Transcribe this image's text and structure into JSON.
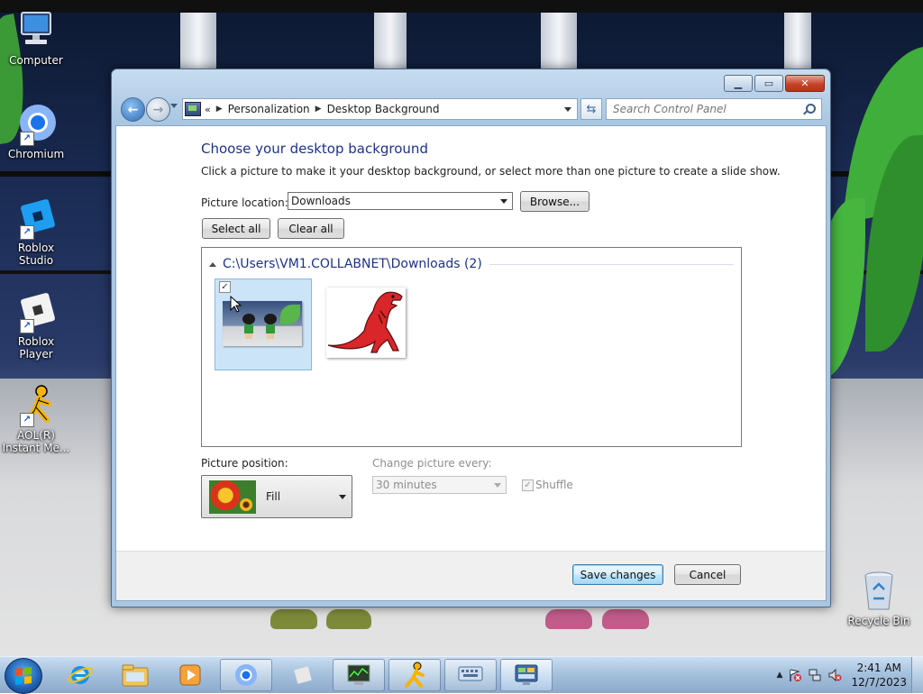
{
  "desktop": {
    "icons": [
      {
        "label": "Computer",
        "icon": "computer-icon"
      },
      {
        "label": "Chromium",
        "icon": "chromium-icon"
      },
      {
        "label": "Roblox Studio",
        "icon": "roblox-studio-icon"
      },
      {
        "label": "Roblox Player",
        "icon": "roblox-player-icon"
      },
      {
        "label": "AOL(R) Instant Me...",
        "icon": "aol-instant-messenger-icon"
      },
      {
        "label": "Recycle Bin",
        "icon": "recycle-bin-icon"
      }
    ]
  },
  "window": {
    "breadcrumb": [
      "Personalization",
      "Desktop Background"
    ],
    "search_placeholder": "Search Control Panel",
    "heading": "Choose your desktop background",
    "subtext": "Click a picture to make it your desktop background, or select more than one picture to create a slide show.",
    "picture_location_label": "Picture location:",
    "picture_location_value": "Downloads",
    "browse_label": "Browse...",
    "select_all_label": "Select all",
    "clear_all_label": "Clear all",
    "group_title": "C:\\Users\\VM1.COLLABNET\\Downloads (2)",
    "pictures": [
      {
        "name": "cartoon-kids-wallpaper",
        "checked": true,
        "selected": true
      },
      {
        "name": "red-dinosaur",
        "checked": false,
        "selected": false
      }
    ],
    "picture_position_label": "Picture position:",
    "picture_position_value": "Fill",
    "change_picture_label": "Change picture every:",
    "change_picture_value": "30 minutes",
    "shuffle_label": "Shuffle",
    "shuffle_checked": true,
    "save_label": "Save changes",
    "cancel_label": "Cancel"
  },
  "taskbar": {
    "pinned": [
      "start-button",
      "internet-explorer-icon",
      "windows-explorer-icon",
      "media-player-icon",
      "chromium-icon",
      "roblox-icon",
      "task-manager-icon",
      "aol-instant-messenger-icon",
      "on-screen-keyboard-icon",
      "control-panel-icon"
    ],
    "active": "control-panel-icon",
    "time": "2:41 AM",
    "date": "12/7/2023"
  },
  "colors": {
    "heading": "#1e3287",
    "selection": "#cce4f7",
    "close_button": "#c5432a"
  }
}
